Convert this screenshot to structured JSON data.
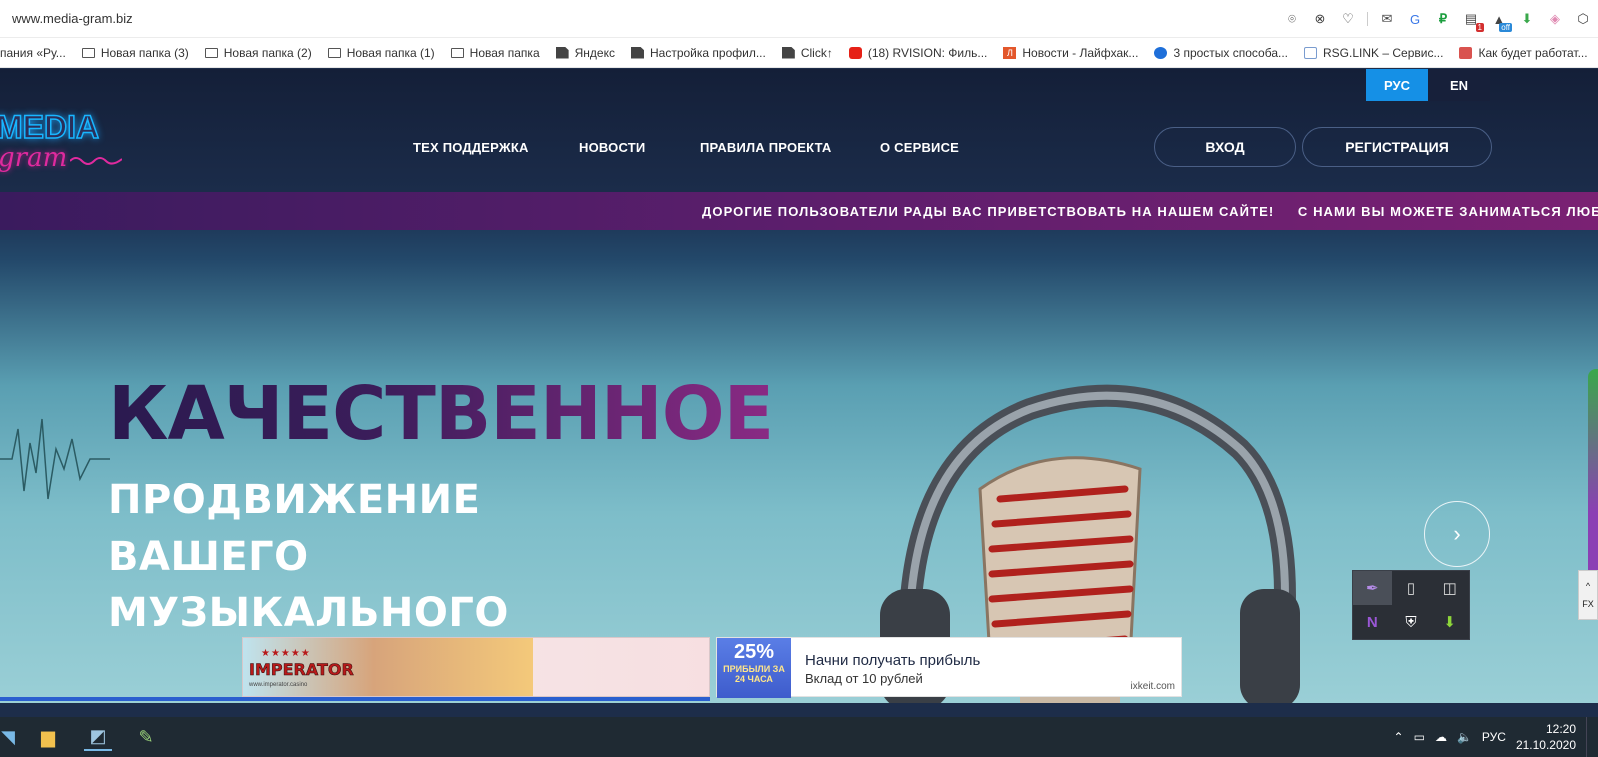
{
  "browser": {
    "url": "www.media-gram.biz",
    "extension_icons": [
      "camera-icon",
      "close-circle-icon",
      "heart-icon",
      "divider",
      "mail-icon",
      "translate-icon",
      "ruble-icon",
      "news-icon",
      "vpn-off-icon",
      "download-icon",
      "cube-icon",
      "box-icon"
    ],
    "badges": {
      "news": "1",
      "vpn": "off"
    },
    "bookmarks": [
      {
        "label": "пания «Ру...",
        "icon": "none"
      },
      {
        "label": "Новая папка (3)",
        "icon": "folder-icon"
      },
      {
        "label": "Новая папка (2)",
        "icon": "folder-icon"
      },
      {
        "label": "Новая папка (1)",
        "icon": "folder-icon"
      },
      {
        "label": "Новая папка",
        "icon": "folder-icon"
      },
      {
        "label": "Яндекс",
        "icon": "doc-icon"
      },
      {
        "label": "Настройка профил...",
        "icon": "doc-icon"
      },
      {
        "label": "Click↑",
        "icon": "doc-icon"
      },
      {
        "label": "(18) RVISION: Филь...",
        "icon": "youtube-icon"
      },
      {
        "label": "Новости - Лайфхак...",
        "icon": "l-icon"
      },
      {
        "label": "3 простых способа...",
        "icon": "blue-circle-icon"
      },
      {
        "label": "RSG.LINK – Сервис...",
        "icon": "rsg-icon"
      },
      {
        "label": "Как будет работат...",
        "icon": "red-icon"
      }
    ]
  },
  "site": {
    "logo": {
      "media": "MEDIA",
      "gram": "gram"
    },
    "lang": {
      "ru": "РУС",
      "en": "EN"
    },
    "nav": [
      "ТЕХ ПОДДЕРЖКА",
      "НОВОСТИ",
      "ПРАВИЛА ПРОЕКТА",
      "О СЕРВИСЕ"
    ],
    "login": "ВХОД",
    "register": "РЕГИСТРАЦИЯ",
    "ticker": "ДОРОГИЕ ПОЛЬЗОВАТЕЛИ РАДЫ ВАС ПРИВЕТСТВОВАТЬ НА НАШЕМ САЙТЕ!     С НАМИ ВЫ МОЖЕТЕ ЗАНИМАТЬСЯ ЛЮБИ",
    "hero": {
      "title": "КАЧЕСТВЕННОЕ",
      "lines": [
        "ПРОДВИЖЕНИЕ",
        "ВАШЕГО",
        "МУЗЫКАЛЬНОГО"
      ]
    },
    "slider_next": "›"
  },
  "ads": {
    "ad1": {
      "brand": "IMPERATOR",
      "stars": "★★★★★",
      "site": "www.imperator.casino"
    },
    "ad2": {
      "percent": "25%",
      "percent_sub": "ПРИБЫЛИ ЗА 24 ЧАСА",
      "title": "Начни получать прибыль",
      "desc": "Вклад от 10 рублей",
      "domain": "ixkeit.com"
    }
  },
  "tray_popup": {
    "icons": [
      "feather-icon",
      "usb-icon",
      "dual-window-icon",
      "onenote-icon",
      "shield-icon",
      "download-arrow-icon"
    ]
  },
  "fx": {
    "up": "^",
    "label": "FX"
  },
  "taskbar": {
    "lang": "РУС",
    "time": "12:20",
    "date": "21.10.2020"
  },
  "colors": {
    "accent_blue": "#1590e6",
    "ticker_purple": "#5c1e6c",
    "logo_pink": "#e02a9e",
    "logo_cyan": "#19b6ff"
  }
}
